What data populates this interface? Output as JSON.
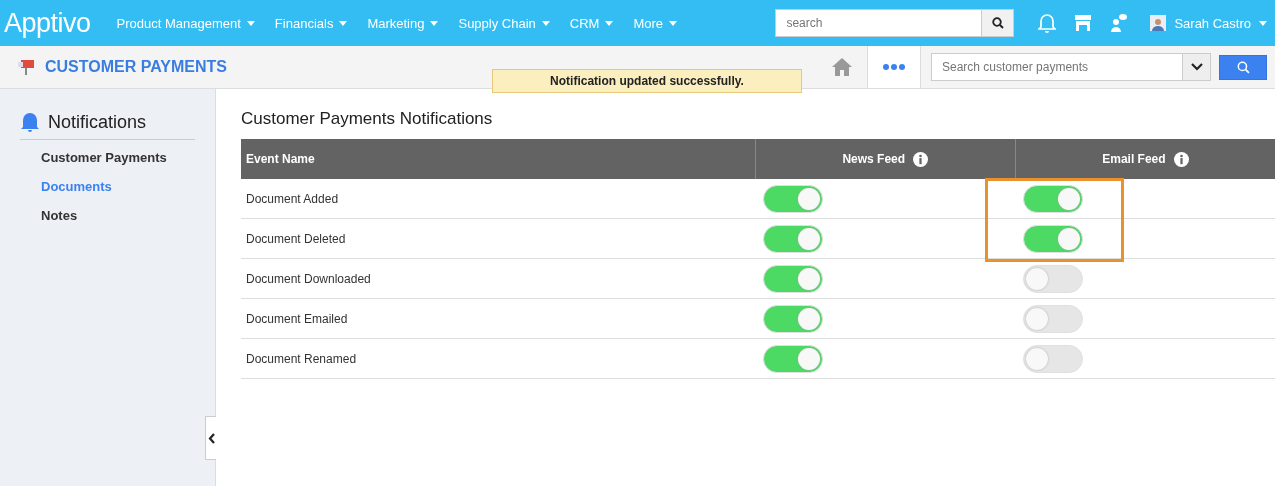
{
  "topbar": {
    "logo": "Apptivo",
    "menu": [
      {
        "label": "Product Management"
      },
      {
        "label": "Financials"
      },
      {
        "label": "Marketing"
      },
      {
        "label": "Supply Chain"
      },
      {
        "label": "CRM"
      },
      {
        "label": "More"
      }
    ],
    "search": {
      "placeholder": "search"
    },
    "user": "Sarah Castro"
  },
  "appbar": {
    "title": "CUSTOMER PAYMENTS",
    "search": {
      "placeholder": "Search customer payments"
    }
  },
  "toast": "Notification updated successfully.",
  "sidebar": {
    "title": "Notifications",
    "items": [
      {
        "label": "Customer Payments",
        "selected": false
      },
      {
        "label": "Documents",
        "selected": true
      },
      {
        "label": "Notes",
        "selected": false
      }
    ]
  },
  "main": {
    "title": "Customer Payments Notifications",
    "columns": [
      "Event Name",
      "News Feed",
      "Email Feed"
    ],
    "rows": [
      {
        "event": "Document Added",
        "news_feed": true,
        "email_feed": true
      },
      {
        "event": "Document Deleted",
        "news_feed": true,
        "email_feed": true
      },
      {
        "event": "Document Downloaded",
        "news_feed": true,
        "email_feed": false
      },
      {
        "event": "Document Emailed",
        "news_feed": true,
        "email_feed": false
      },
      {
        "event": "Document Renamed",
        "news_feed": true,
        "email_feed": false
      }
    ]
  }
}
